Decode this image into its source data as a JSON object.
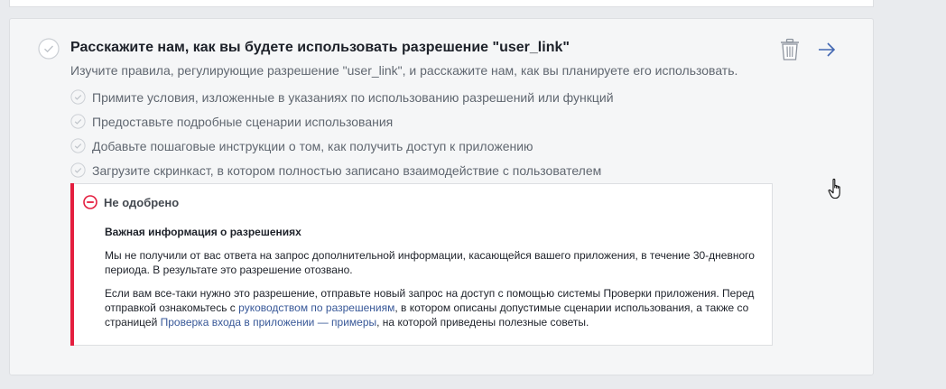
{
  "permission_step": {
    "title": "Расскажите нам, как вы будете использовать разрешение \"user_link\"",
    "subtitle": "Изучите правила, регулирующие разрешение \"user_link\", и расскажите нам, как вы планируете его использовать.",
    "requirements": [
      "Примите условия, изложенные в указаниях по использованию разрешений или функций",
      "Предоставьте подробные сценарии использования",
      "Добавьте пошаговые инструкции о том, как получить доступ к приложению",
      "Загрузите скринкаст, в котором полностью записано взаимодействие с пользователем"
    ],
    "icons": {
      "status": "check-circle-icon",
      "delete": "trash-icon",
      "open": "arrow-right-icon"
    }
  },
  "notice": {
    "status": "Не одобрено",
    "status_color": "#e41e3f",
    "heading": "Важная информация о разрешениях",
    "paragraph1": "Мы не получили от вас ответа на запрос дополнительной информации, касающейся вашего приложения, в течение 30-дневного периода. В результате это разрешение отозвано.",
    "paragraph2_part1": "Если вам все-таки нужно это разрешение, отправьте новый запрос на доступ с помощью системы Проверки приложения. Перед отправкой ознакомьтесь с ",
    "link1": "руководством по разрешениям",
    "paragraph2_part2": ", в котором описаны допустимые сценарии использования, а также со страницей ",
    "link2": "Проверка входа в приложении — примеры",
    "paragraph2_part3": ", на которой приведены полезные советы."
  },
  "colors": {
    "link": "#385898",
    "arrow": "#4267b2",
    "muted_check": "#bec3c9"
  }
}
